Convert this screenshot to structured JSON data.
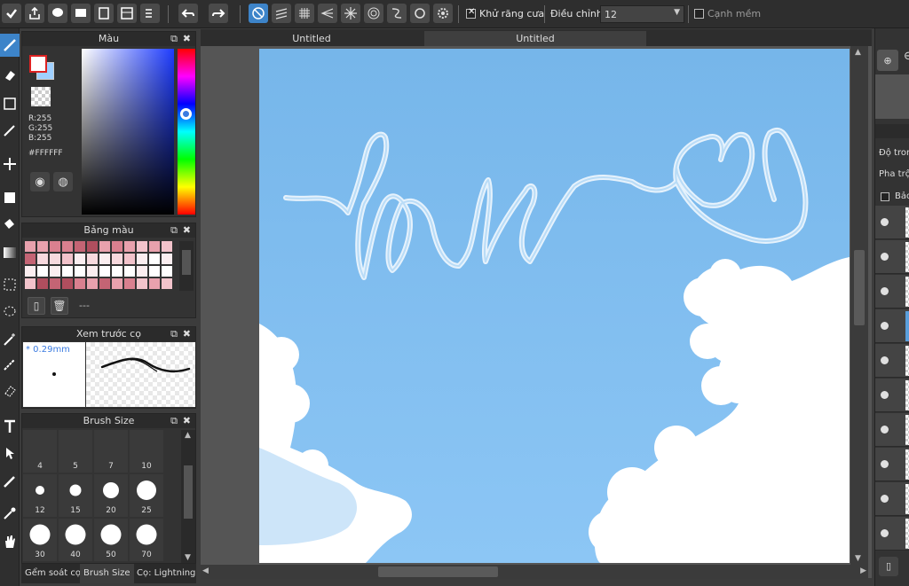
{
  "toolbar": {
    "antialias_label": "Khử răng cưa",
    "adjust_label": "Điều chỉnh",
    "adjust_value": "12",
    "soft_edge_label": "Cạnh mềm"
  },
  "tools": [
    "brush-icon",
    "eraser-icon",
    "rect-icon",
    "pen-icon",
    "move-icon",
    "fill-rect-icon",
    "bucket-icon",
    "gradient-icon",
    "select-rect-icon",
    "lasso-icon",
    "magic-wand-icon",
    "select-pen-icon",
    "select-eraser-icon",
    "text-icon",
    "operation-icon",
    "dropper-pen-icon",
    "eyedropper-icon",
    "hand-icon"
  ],
  "color_panel": {
    "title": "Màu",
    "r": "R:255",
    "g": "G:255",
    "b": "B:255",
    "hex": "#FFFFFF",
    "fg_color": "#FFFFFF",
    "bg_color": "#9FD0FF"
  },
  "palette_panel": {
    "title": "Bảng màu",
    "status": "---",
    "colors": [
      "#e8a1ad",
      "#e8a1ad",
      "#d9808f",
      "#d9808f",
      "#c46474",
      "#b04e5e",
      "#e8a1ad",
      "#d9808f",
      "#e8a1ad",
      "#f2c3cb",
      "#e8a1ad",
      "#f2c3cb",
      "#c46474",
      "#f7d9de",
      "#f7d9de",
      "#f2c3cb",
      "#fbeef0",
      "#f7d9de",
      "#fbeef0",
      "#f7d9de",
      "#f2c3cb",
      "#fbeef0",
      "#ffffff",
      "#fbeef0",
      "#fbeef0",
      "#ffffff",
      "#fbeef0",
      "#ffffff",
      "#ffffff",
      "#fbeef0",
      "#ffffff",
      "#ffffff",
      "#ffffff",
      "#fbeef0",
      "#ffffff",
      "#ffffff",
      "#f2c3cb",
      "#b04e5e",
      "#c46474",
      "#b04e5e",
      "#d9808f",
      "#e8a1ad",
      "#c46474",
      "#e8a1ad",
      "#d9808f",
      "#f2c3cb",
      "#e8a1ad",
      "#f2c3cb"
    ]
  },
  "preview_panel": {
    "title": "Xem trước cọ",
    "size": "* 0.29mm"
  },
  "brush_panel": {
    "title": "Brush Size",
    "sizes": [
      {
        "label": "4",
        "d": 0
      },
      {
        "label": "5",
        "d": 0
      },
      {
        "label": "7",
        "d": 0
      },
      {
        "label": "10",
        "d": 0
      },
      {
        "label": "12",
        "d": 10
      },
      {
        "label": "15",
        "d": 13
      },
      {
        "label": "20",
        "d": 18
      },
      {
        "label": "25",
        "d": 22
      },
      {
        "label": "30",
        "d": 23
      },
      {
        "label": "40",
        "d": 23
      },
      {
        "label": "50",
        "d": 23
      },
      {
        "label": "70",
        "d": 23
      }
    ]
  },
  "bottom_tabs": {
    "tab1": "Gểm soát cọ",
    "tab2": "Brush Size",
    "tab3": "Cọ: Lightning"
  },
  "doc_tabs": {
    "tab1": "Untitled",
    "tab2": "Untitled"
  },
  "right_panel": {
    "label1": "Độ tron",
    "label2": "Pha trộ",
    "label3": "Bảo"
  },
  "canvas": {
    "sky_top": "#7ab8ec",
    "sky_bottom": "#8cc6f5",
    "text_color": "#d9ecfb"
  }
}
